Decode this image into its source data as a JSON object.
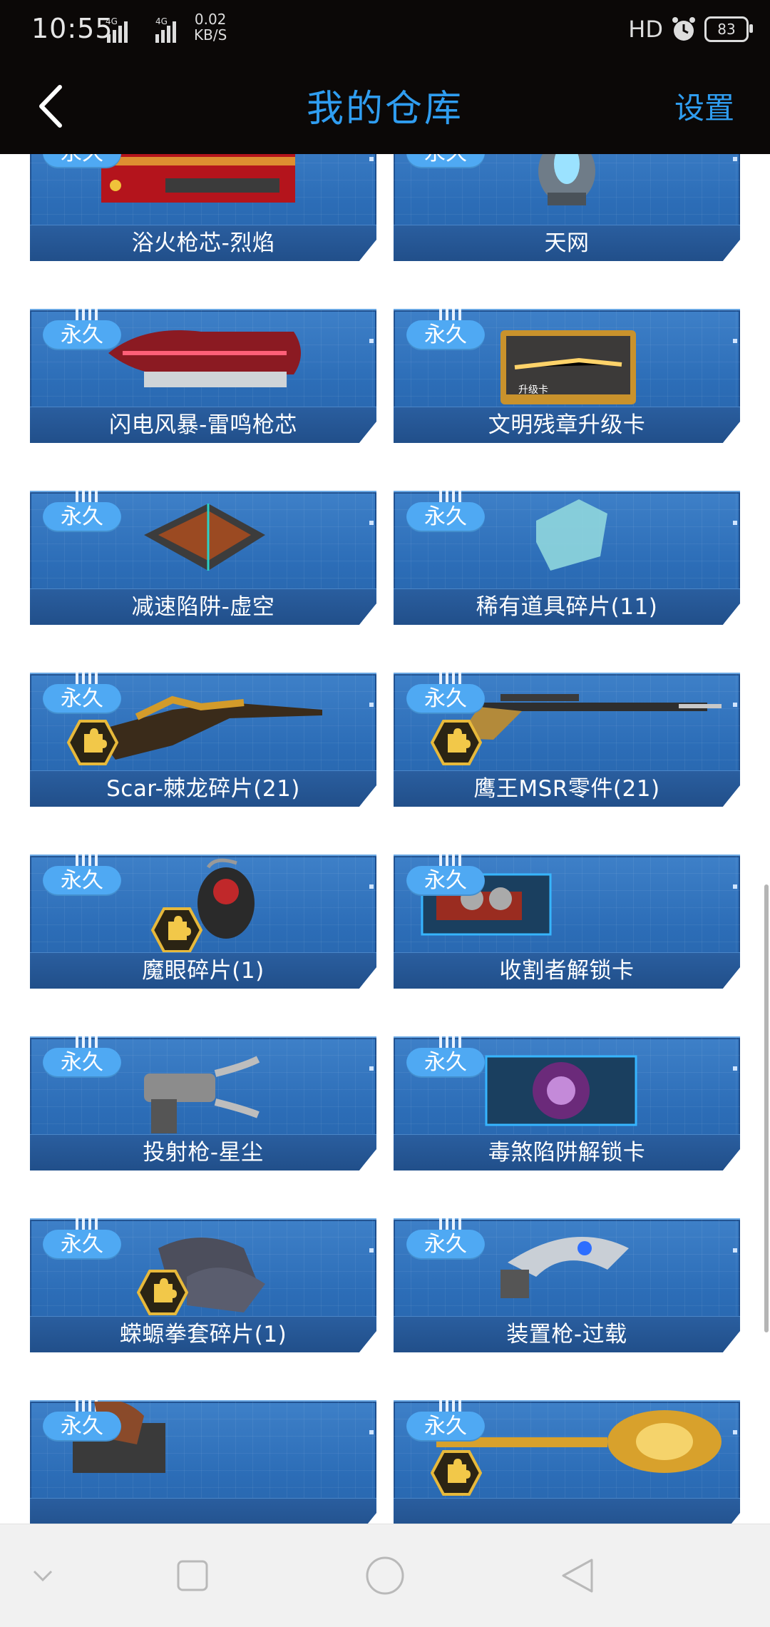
{
  "status_bar": {
    "time": "10:55",
    "network_1": "4G",
    "network_2": "4G",
    "speed_value": "0.02",
    "speed_unit": "KB/S",
    "hd": "HD",
    "battery": "83"
  },
  "header": {
    "title": "我的仓库",
    "settings_label": "设置"
  },
  "items": [
    {
      "name": "浴火枪芯-烈焰",
      "badge": "永久",
      "art": "red-gun-core",
      "puzzle": false
    },
    {
      "name": "天网",
      "badge": "永久",
      "art": "drone",
      "puzzle": false
    },
    {
      "name": "闪电风暴-雷鸣枪芯",
      "badge": "永久",
      "art": "lightning-gun-core",
      "puzzle": false
    },
    {
      "name": "文明残章升级卡",
      "badge": "永久",
      "art": "upgrade-card",
      "puzzle": false
    },
    {
      "name": "减速陷阱-虚空",
      "badge": "永久",
      "art": "trap",
      "puzzle": false
    },
    {
      "name": "稀有道具碎片(11)",
      "badge": "永久",
      "art": "crystal-shard",
      "puzzle": false
    },
    {
      "name": "Scar-棘龙碎片(21)",
      "badge": "永久",
      "art": "rifle-gold",
      "puzzle": true
    },
    {
      "name": "鹰王MSR零件(21)",
      "badge": "永久",
      "art": "sniper-rifle",
      "puzzle": true
    },
    {
      "name": "魔眼碎片(1)",
      "badge": "永久",
      "art": "grenade",
      "puzzle": true
    },
    {
      "name": "收割者解锁卡",
      "badge": "永久",
      "art": "reaper-card",
      "puzzle": false
    },
    {
      "name": "投射枪-星尘",
      "badge": "永久",
      "art": "projector-gun",
      "puzzle": false
    },
    {
      "name": "毒煞陷阱解锁卡",
      "badge": "永久",
      "art": "poison-trap-card",
      "puzzle": false
    },
    {
      "name": "蝾螈拳套碎片(1)",
      "badge": "永久",
      "art": "gauntlet",
      "puzzle": true
    },
    {
      "name": "装置枪-过载",
      "badge": "永久",
      "art": "device-gun",
      "puzzle": false
    },
    {
      "name": "",
      "badge": "永久",
      "art": "partial-item-left",
      "puzzle": false
    },
    {
      "name": "",
      "badge": "永久",
      "art": "golden-staff",
      "puzzle": true
    }
  ],
  "icons": {
    "back": "chevron-left-icon",
    "nav_recent": "chevron-down-icon",
    "nav_square": "square-icon",
    "nav_home": "circle-icon",
    "nav_back": "triangle-back-icon",
    "puzzle": "puzzle-piece-icon"
  },
  "colors": {
    "header_bg": "#0b0807",
    "title": "#2f9df0",
    "card_blue": "#2c6db7",
    "badge": "#4fa9f3"
  }
}
